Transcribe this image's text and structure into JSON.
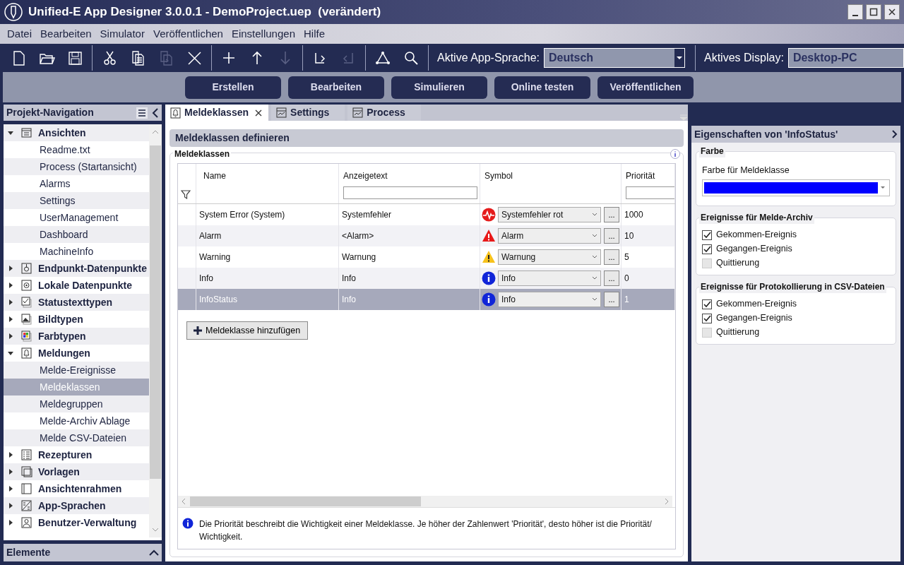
{
  "window": {
    "title": "Unified-E App Designer 3.0.0.1 - DemoProject.uep  (verändert)"
  },
  "menu": [
    "Datei",
    "Bearbeiten",
    "Simulator",
    "Veröffentlichen",
    "Einstellungen",
    "Hilfe"
  ],
  "toolbar": {
    "tools": [
      {
        "kind": "new",
        "disabled": false
      },
      {
        "kind": "open",
        "disabled": false
      },
      {
        "kind": "save",
        "disabled": false
      },
      {
        "kind": "sep"
      },
      {
        "kind": "cut",
        "disabled": false
      },
      {
        "kind": "copy",
        "disabled": false
      },
      {
        "kind": "paste",
        "disabled": true
      },
      {
        "kind": "delete",
        "disabled": false
      },
      {
        "kind": "sep"
      },
      {
        "kind": "add",
        "disabled": false
      },
      {
        "kind": "up",
        "disabled": false
      },
      {
        "kind": "down",
        "disabled": true
      },
      {
        "kind": "sep"
      },
      {
        "kind": "undo",
        "disabled": false
      },
      {
        "kind": "redo",
        "disabled": true
      },
      {
        "kind": "sep"
      },
      {
        "kind": "network",
        "disabled": false
      },
      {
        "kind": "search",
        "disabled": false
      },
      {
        "kind": "sep"
      }
    ],
    "language_label": "Aktive App-Sprache:",
    "language_value": "Deutsch",
    "display_label": "Aktives Display:",
    "display_value": "Desktop-PC"
  },
  "actions": [
    "Erstellen",
    "Bearbeiten",
    "Simulieren",
    "Online testen",
    "Veröffentlichen"
  ],
  "navigation": {
    "title": "Projekt-Navigation",
    "items": [
      {
        "label": "Ansichten",
        "kind": "views",
        "expanded": true,
        "children": [
          {
            "label": "Readme.txt",
            "selected": false
          },
          {
            "label": "Process (Startansicht)",
            "selected": false
          },
          {
            "label": "Alarms",
            "selected": false
          },
          {
            "label": "Settings",
            "selected": false
          },
          {
            "label": "UserManagement",
            "selected": false
          },
          {
            "label": "Dashboard",
            "selected": false
          },
          {
            "label": "MachineInfo",
            "selected": false
          }
        ]
      },
      {
        "label": "Endpunkt-Datenpunkte",
        "kind": "endpoint",
        "expanded": false
      },
      {
        "label": "Lokale Datenpunkte",
        "kind": "local",
        "expanded": false
      },
      {
        "label": "Statustexttypen",
        "kind": "statustext",
        "expanded": false
      },
      {
        "label": "Bildtypen",
        "kind": "image",
        "expanded": false
      },
      {
        "label": "Farbtypen",
        "kind": "color",
        "expanded": false
      },
      {
        "label": "Meldungen",
        "kind": "alarm",
        "expanded": true,
        "children": [
          {
            "label": "Melde-Ereignisse",
            "selected": false
          },
          {
            "label": "Meldeklassen",
            "selected": true
          },
          {
            "label": "Meldegruppen",
            "selected": false
          },
          {
            "label": "Melde-Archiv Ablage",
            "selected": false
          },
          {
            "label": "Melde CSV-Dateien",
            "selected": false
          }
        ]
      },
      {
        "label": "Rezepturen",
        "kind": "recipe",
        "expanded": false
      },
      {
        "label": "Vorlagen",
        "kind": "template",
        "expanded": false
      },
      {
        "label": "Ansichtenrahmen",
        "kind": "frame",
        "expanded": false
      },
      {
        "label": "App-Sprachen",
        "kind": "language",
        "expanded": false
      },
      {
        "label": "Benutzer-Verwaltung",
        "kind": "user",
        "expanded": false
      }
    ]
  },
  "elements_panel": {
    "title": "Elemente"
  },
  "tabs": [
    {
      "label": "Meldeklassen",
      "kind": "alarm",
      "selected": true
    },
    {
      "label": "Settings",
      "kind": "view",
      "selected": false
    },
    {
      "label": "Process",
      "kind": "view",
      "selected": false
    }
  ],
  "editor": {
    "heading": "Meldeklassen definieren",
    "group": "Meldeklassen",
    "table": {
      "columns": [
        "Name",
        "Anzeigetext",
        "Symbol",
        "Priorität"
      ],
      "rows": [
        {
          "name": "System Error (System)",
          "text": "Systemfehler",
          "kind": "error",
          "symbol_label": "Systemfehler rot",
          "browse": "...",
          "priority": "1000",
          "selected": false
        },
        {
          "name": "Alarm",
          "text": "<Alarm>",
          "kind": "alarm",
          "symbol_label": "Alarm",
          "browse": "...",
          "priority": "10",
          "selected": false
        },
        {
          "name": "Warning",
          "text": "Warnung",
          "kind": "warning",
          "symbol_label": "Warnung",
          "browse": "...",
          "priority": "5",
          "selected": false
        },
        {
          "name": "Info",
          "text": "Info",
          "kind": "info",
          "symbol_label": "Info",
          "browse": "...",
          "priority": "0",
          "selected": false
        },
        {
          "name": "InfoStatus",
          "text": "Info",
          "kind": "info",
          "symbol_label": "Info",
          "browse": "...",
          "priority": "1",
          "selected": true
        }
      ]
    },
    "add_button": "Meldeklasse hinzufügen",
    "note": "Die Priorität beschreibt die Wichtigkeit einer Meldeklasse. Je höher der Zahlenwert 'Priorität', desto höher ist die Priorität/ Wichtigkeit."
  },
  "properties": {
    "title": "Eigenschaften von 'InfoStatus'",
    "color_group": {
      "title": "Farbe",
      "label": "Farbe für Meldeklasse",
      "color": "#0000ff"
    },
    "groups": [
      {
        "title": "Ereignisse für Melde-Archiv",
        "options": [
          {
            "label": "Gekommen-Ereignis",
            "checked": true
          },
          {
            "label": "Gegangen-Ereignis",
            "checked": true
          },
          {
            "label": "Quittierung",
            "checked": false
          }
        ]
      },
      {
        "title": "Ereignisse für Protokollierung in CSV-Dateien",
        "options": [
          {
            "label": "Gekommen-Ereignis",
            "checked": true
          },
          {
            "label": "Gegangen-Ereignis",
            "checked": true
          },
          {
            "label": "Quittierung",
            "checked": false
          }
        ]
      }
    ]
  }
}
